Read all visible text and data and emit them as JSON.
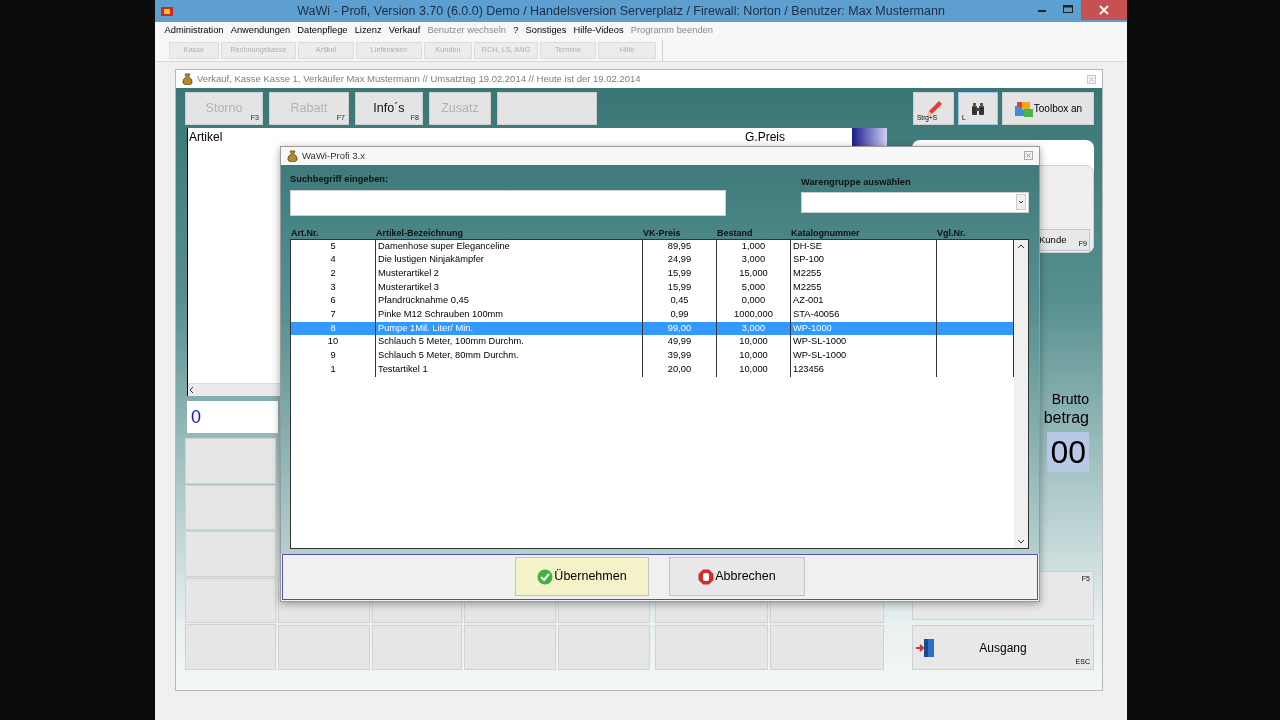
{
  "window": {
    "title": "WaWi - Profi, Version 3.70 (6.0.0) Demo / Handelsversion Serverplatz / Firewall: Norton / Benutzer: Max Mustermann"
  },
  "menu": [
    {
      "label": "Administration",
      "disabled": false
    },
    {
      "label": "Anwendungen",
      "disabled": false
    },
    {
      "label": "Datenpflege",
      "disabled": false
    },
    {
      "label": "Lizenz",
      "disabled": false
    },
    {
      "label": "Verkauf",
      "disabled": false
    },
    {
      "label": "Benutzer wechseln",
      "disabled": true
    },
    {
      "label": "?",
      "disabled": false
    },
    {
      "label": "Sonstiges",
      "disabled": false
    },
    {
      "label": "Hilfe-Videos",
      "disabled": false
    },
    {
      "label": "Programm beenden",
      "disabled": true
    }
  ],
  "toolbar": [
    {
      "label": "Kasse",
      "disabled": true
    },
    {
      "label": "Rechnungskasse",
      "disabled": true
    },
    {
      "label": "Artikel",
      "disabled": true
    },
    {
      "label": "Lieferanten",
      "disabled": true
    },
    {
      "label": "Kunden",
      "disabled": true
    },
    {
      "label": "RCH, LS, ANG",
      "disabled": true
    },
    {
      "label": "Termine",
      "disabled": true
    },
    {
      "label": "Hilfe",
      "disabled": true
    }
  ],
  "sales_window": {
    "title": "Verkauf, Kasse Kasse 1, Verkäufer Max Mustermann // Umsatztag 19.02.2014 // Heute ist der 19.02.2014",
    "buttons": [
      {
        "kind": "text",
        "label": "Storno",
        "key": "F3",
        "disabled": true
      },
      {
        "kind": "text",
        "label": "Rabatt",
        "key": "F7",
        "disabled": true
      },
      {
        "kind": "text",
        "label": "Info´s",
        "key": "F8",
        "disabled": false
      },
      {
        "kind": "text",
        "label": "Zusatz",
        "disabled": true
      },
      {
        "kind": "blank"
      }
    ],
    "tools": [
      {
        "kind": "pencil",
        "key": "Strg+S"
      },
      {
        "kind": "binoculars",
        "key": "L"
      },
      {
        "kind": "toolbox",
        "label": "Toolbox an"
      }
    ],
    "columns": [
      "Artikel",
      "G.Preis"
    ],
    "quantity": "0",
    "customer_button": {
      "label": "Kunde",
      "key": "F9"
    },
    "total": {
      "label": "Brutto",
      "sublabel": "betrag",
      "amount": "00"
    },
    "pay_button": {
      "key": "F5"
    },
    "exit_button": {
      "label": "Ausgang",
      "key": "ESC"
    }
  },
  "dialog": {
    "title": "WaWi-Profi 3.x",
    "search_label": "Suchbegriff eingeben:",
    "group_label": "Warengruppe auswählen",
    "columns": [
      "Art.Nr.",
      "Artikel-Bezeichnung",
      "VK-Preis",
      "Bestand",
      "Katalognummer",
      "Vgl.Nr."
    ],
    "rows": [
      {
        "cells": [
          "5",
          "Damenhose super Eleganceline",
          "89,95",
          "1,000",
          "DH-SE"
        ],
        "selected": false
      },
      {
        "cells": [
          "4",
          "Die lustigen Ninjakämpfer",
          "24,99",
          "3,000",
          "SP-100"
        ],
        "selected": false
      },
      {
        "cells": [
          "2",
          "Musterartikel 2",
          "15,99",
          "15,000",
          "M2255"
        ],
        "selected": false
      },
      {
        "cells": [
          "3",
          "Musterartikel 3",
          "15,99",
          "5,000",
          "M2255"
        ],
        "selected": false
      },
      {
        "cells": [
          "6",
          "Pfandrücknahme 0,45",
          "0,45",
          "0,000",
          "AZ-001"
        ],
        "selected": false
      },
      {
        "cells": [
          "7",
          "Pinke M12 Schrauben 100mm",
          "0,99",
          "1000,000",
          "STA-40056"
        ],
        "selected": false
      },
      {
        "cells": [
          "8",
          "Pumpe 1Mil. Liter/ Min.",
          "99,00",
          "3,000",
          "WP-1000"
        ],
        "selected": true
      },
      {
        "cells": [
          "10",
          "Schlauch 5 Meter, 100mm Durchm.",
          "49,99",
          "10,000",
          "WP-SL-1000"
        ],
        "selected": false
      },
      {
        "cells": [
          "9",
          "Schlauch 5 Meter, 80mm Durchm.",
          "39,99",
          "10,000",
          "WP-SL-1000"
        ],
        "selected": false
      },
      {
        "cells": [
          "1",
          "Testartikel 1",
          "20,00",
          "10,000",
          "123456"
        ],
        "selected": false
      }
    ],
    "buttons": [
      {
        "kind": "ok",
        "label": "Übernehmen"
      },
      {
        "kind": "cancel",
        "label": "Abbrechen"
      }
    ]
  }
}
